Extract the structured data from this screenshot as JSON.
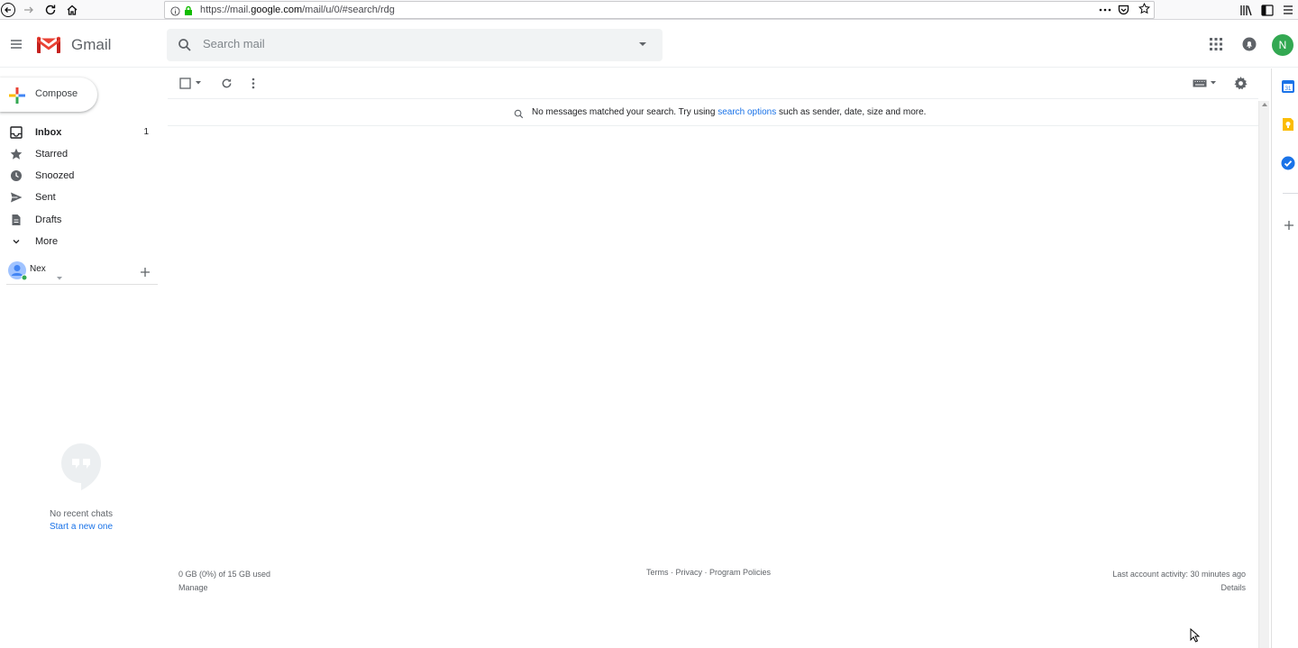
{
  "browser": {
    "url_prefix": "https://mail.",
    "url_domain": "google.com",
    "url_suffix": "/mail/u/0/#search/rdg"
  },
  "header": {
    "app_name": "Gmail",
    "search_placeholder": "Search mail",
    "avatar_letter": "N",
    "avatar_color": "#33a852"
  },
  "nav": {
    "compose_label": "Compose",
    "items": [
      {
        "label": "Inbox",
        "count": "1",
        "icon": "inbox-icon"
      },
      {
        "label": "Starred",
        "count": "",
        "icon": "star-icon"
      },
      {
        "label": "Snoozed",
        "count": "",
        "icon": "clock-icon"
      },
      {
        "label": "Sent",
        "count": "",
        "icon": "send-icon"
      },
      {
        "label": "Drafts",
        "count": "",
        "icon": "draft-icon"
      },
      {
        "label": "More",
        "count": "",
        "icon": "chevron-down-icon"
      }
    ],
    "hangouts_user": "Nex",
    "chat_empty": "No recent chats",
    "chat_start": "Start a new one"
  },
  "main": {
    "empty_prefix": "No messages matched your search. Try using ",
    "empty_link": "search options",
    "empty_suffix": " such as sender, date, size and more."
  },
  "footer": {
    "storage": "0 GB (0%) of 15 GB used",
    "manage": "Manage",
    "terms": "Terms",
    "privacy": "Privacy",
    "policies": "Program Policies",
    "sep": " · ",
    "activity": "Last account activity: 30 minutes ago",
    "details": "Details"
  },
  "colors": {
    "accent_blue": "#1a73e8",
    "gmail_red": "#ea4335"
  }
}
